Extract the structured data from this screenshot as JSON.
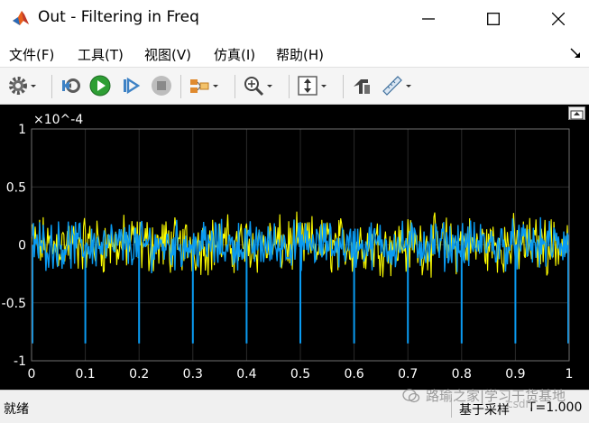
{
  "window": {
    "title": "Out - Filtering in Freq"
  },
  "menu": {
    "items": [
      "文件(F)",
      "工具(T)",
      "视图(V)",
      "仿真(I)",
      "帮助(H)"
    ]
  },
  "toolbar": {
    "icons": [
      "gear-icon",
      "step-back-icon",
      "run-icon",
      "step-forward-icon",
      "stop-icon",
      "signal-select-icon",
      "zoom-icon",
      "autoscale-icon",
      "highlight-icon",
      "measure-icon"
    ]
  },
  "status": {
    "text": "就绪",
    "right_text": "基于采样",
    "right_text2": "T=1.000"
  },
  "watermark": {
    "text": "路瑜之家|学习干货基地",
    "csdn": "csdn"
  },
  "colors": {
    "series1": "#ffff00",
    "series2": "#0a9bf2",
    "background": "#000000",
    "grid": "#2a2a2a"
  },
  "chart_data": {
    "type": "line",
    "title": "",
    "xlabel": "",
    "ylabel": "",
    "xlim": [
      0,
      1
    ],
    "ylim": [
      -1,
      1
    ],
    "y_multiplier": "×10^-4",
    "grid": true,
    "x_ticks": [
      "0",
      "0.1",
      "0.2",
      "0.3",
      "0.4",
      "0.5",
      "0.6",
      "0.7",
      "0.8",
      "0.9",
      "1"
    ],
    "y_ticks": [
      "1",
      "0.5",
      "0",
      "-0.5",
      "-1"
    ],
    "series": [
      {
        "color": "#ffff00",
        "amplitude": 0.3
      },
      {
        "color": "#0a9bf2",
        "amplitude": 0.25,
        "spikes_at": [
          0.0,
          0.1,
          0.2,
          0.3,
          0.4,
          0.5,
          0.6,
          0.7,
          0.8,
          0.9,
          1.0
        ],
        "spike_value": -0.85
      }
    ]
  }
}
